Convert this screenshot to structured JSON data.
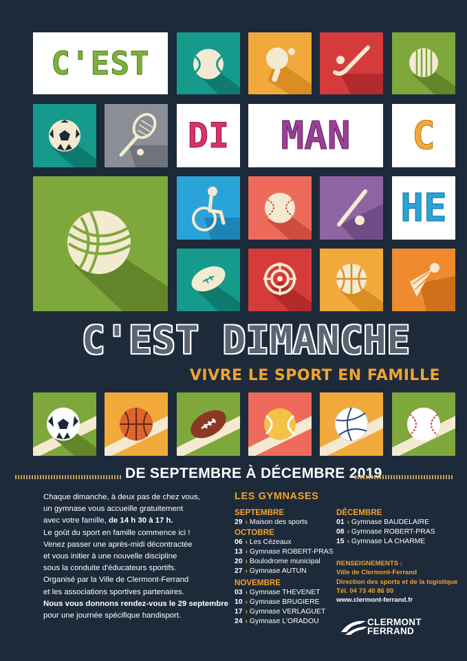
{
  "title_tiles": {
    "cest": "C'EST",
    "di": "DI",
    "man": "MAN",
    "c": "C",
    "he": "HE"
  },
  "headline": "C'EST DIMANCHE",
  "subline": "VIVRE LE SPORT EN FAMILLE",
  "period": "DE SEPTEMBRE À DÉCEMBRE 2019",
  "intro": {
    "l1": "Chaque dimanche, à deux pas de chez vous,",
    "l2": "un gymnase vous accueille gratuitement",
    "l3a": "avec votre famille, ",
    "l3b": "de 14 h 30 à 17 h.",
    "l4": "Le goût du sport en famille commence ici !",
    "l5": "Venez passer une après-midi décontractée",
    "l6": "et vous initier à une nouvelle discipline",
    "l7": "sous la conduite d'éducateurs sportifs.",
    "l8": "Organisé par la Ville de Clermont-Ferrand",
    "l9": "et les associations sportives partenaires.",
    "l10": "Nous vous donnons rendez-vous le 29 septembre",
    "l11": "pour une journée spécifique handisport."
  },
  "gymnases": {
    "title": "LES GYMNASES",
    "septembre": {
      "label": "SEPTEMBRE",
      "items": [
        {
          "day": "29",
          "place": "Maison des sports"
        }
      ]
    },
    "octobre": {
      "label": "OCTOBRE",
      "items": [
        {
          "day": "06",
          "place": "Les Cézeaux"
        },
        {
          "day": "13",
          "place": "Gymnase ROBERT-PRAS"
        },
        {
          "day": "20",
          "place": "Boulodrome municipal"
        },
        {
          "day": "27",
          "place": "Gymnase AUTUN"
        }
      ]
    },
    "novembre": {
      "label": "NOVEMBRE",
      "items": [
        {
          "day": "03",
          "place": "Gymnase THEVENET"
        },
        {
          "day": "10",
          "place": "Gymnase BRUGIERE"
        },
        {
          "day": "17",
          "place": "Gymnase VERLAGUET"
        },
        {
          "day": "24",
          "place": "Gymnase L'ORADOU"
        }
      ]
    },
    "decembre": {
      "label": "DÉCEMBRE",
      "items": [
        {
          "day": "01",
          "place": "Gymnase BAUDELAIRE"
        },
        {
          "day": "08",
          "place": "Gymnase ROBERT-PRAS"
        },
        {
          "day": "15",
          "place": "Gymnase LA CHARME"
        }
      ]
    },
    "chevron": "›"
  },
  "renseignements": {
    "label": "RENSEIGNEMENTS :",
    "l1": "Ville de Clermont-Ferrand",
    "l2": "Direction des sports et de la logistique",
    "tel": "Tél. 04 73 40 86 00",
    "web": "www.clermont-ferrand.fr"
  },
  "logo": {
    "line1": "CLERMONT",
    "line2": "FERRAND"
  },
  "colors": {
    "background": "#1d2a3a",
    "green": "#7fa83c",
    "teal": "#159a8c",
    "yellow": "#f2a93b",
    "red": "#d63b3c",
    "orange": "#f08a2f",
    "blue": "#2aa3d8",
    "purple": "#8e64a3",
    "salmon": "#ee6b5b",
    "gray": "#8a8f96",
    "accent": "#f2a330"
  },
  "icons": [
    "tennis-ball-icon",
    "ping-pong-icon",
    "field-hockey-icon",
    "boules-icon",
    "soccer-ball-icon",
    "badminton-racket-icon",
    "petanque-ball-icon",
    "handisport-wheelchair-icon",
    "baseball-icon",
    "cricket-bat-icon",
    "rugby-ball-icon",
    "archery-target-icon",
    "basketball-icon",
    "shuttlecock-icon",
    "volleyball-icon"
  ]
}
